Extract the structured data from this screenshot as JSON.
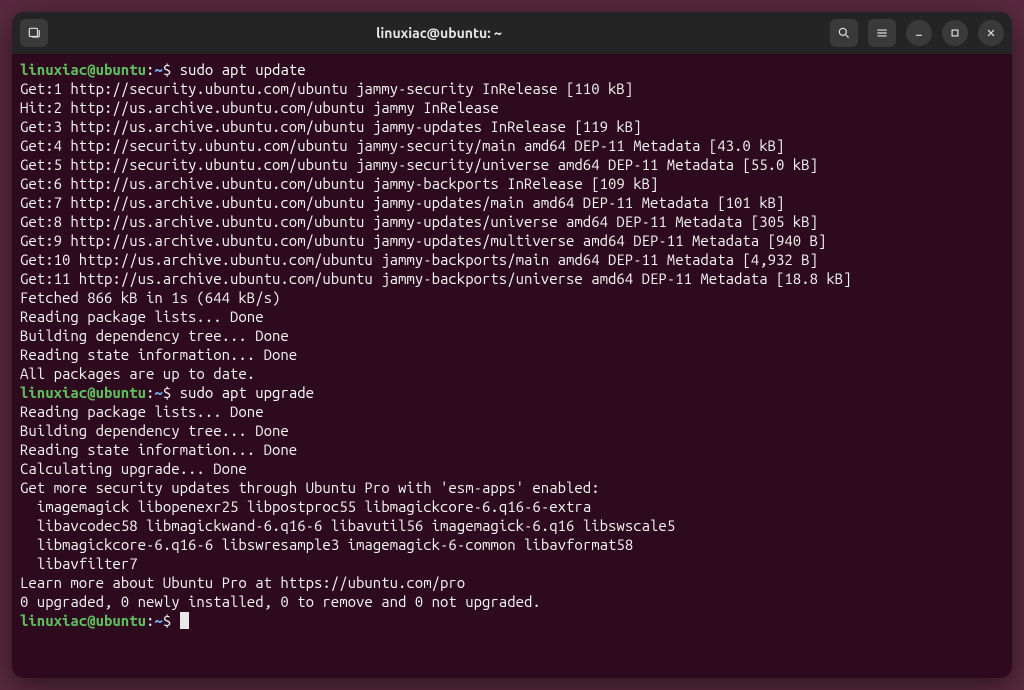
{
  "window": {
    "title": "linuxiac@ubuntu: ~"
  },
  "prompt": {
    "user": "linuxiac",
    "host": "ubuntu",
    "path": "~"
  },
  "session1": {
    "command": "sudo apt update",
    "output": [
      "Get:1 http://security.ubuntu.com/ubuntu jammy-security InRelease [110 kB]",
      "Hit:2 http://us.archive.ubuntu.com/ubuntu jammy InRelease",
      "Get:3 http://us.archive.ubuntu.com/ubuntu jammy-updates InRelease [119 kB]",
      "Get:4 http://security.ubuntu.com/ubuntu jammy-security/main amd64 DEP-11 Metadata [43.0 kB]",
      "Get:5 http://security.ubuntu.com/ubuntu jammy-security/universe amd64 DEP-11 Metadata [55.0 kB]",
      "Get:6 http://us.archive.ubuntu.com/ubuntu jammy-backports InRelease [109 kB]",
      "Get:7 http://us.archive.ubuntu.com/ubuntu jammy-updates/main amd64 DEP-11 Metadata [101 kB]",
      "Get:8 http://us.archive.ubuntu.com/ubuntu jammy-updates/universe amd64 DEP-11 Metadata [305 kB]",
      "Get:9 http://us.archive.ubuntu.com/ubuntu jammy-updates/multiverse amd64 DEP-11 Metadata [940 B]",
      "Get:10 http://us.archive.ubuntu.com/ubuntu jammy-backports/main amd64 DEP-11 Metadata [4,932 B]",
      "Get:11 http://us.archive.ubuntu.com/ubuntu jammy-backports/universe amd64 DEP-11 Metadata [18.8 kB]",
      "Fetched 866 kB in 1s (644 kB/s)",
      "Reading package lists... Done",
      "Building dependency tree... Done",
      "Reading state information... Done",
      "All packages are up to date."
    ]
  },
  "session2": {
    "command": "sudo apt upgrade",
    "output": [
      "Reading package lists... Done",
      "Building dependency tree... Done",
      "Reading state information... Done",
      "Calculating upgrade... Done",
      "Get more security updates through Ubuntu Pro with 'esm-apps' enabled:",
      "  imagemagick libopenexr25 libpostproc55 libmagickcore-6.q16-6-extra",
      "  libavcodec58 libmagickwand-6.q16-6 libavutil56 imagemagick-6.q16 libswscale5",
      "  libmagickcore-6.q16-6 libswresample3 imagemagick-6-common libavformat58",
      "  libavfilter7",
      "Learn more about Ubuntu Pro at https://ubuntu.com/pro",
      "0 upgraded, 0 newly installed, 0 to remove and 0 not upgraded."
    ]
  }
}
